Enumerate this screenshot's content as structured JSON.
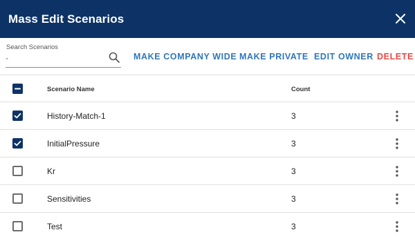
{
  "dialog": {
    "title": "Mass Edit Scenarios"
  },
  "search": {
    "label": "Search Scenarios",
    "value": "",
    "placeholder": "-"
  },
  "actions": {
    "make_company_wide": "MAKE COMPANY WIDE",
    "make_private": "MAKE PRIVATE",
    "edit_owner": "EDIT OWNER",
    "delete": "DELETE"
  },
  "table": {
    "headers": {
      "name": "Scenario Name",
      "count": "Count"
    },
    "select_all_state": "indeterminate",
    "rows": [
      {
        "name": "History-Match-1",
        "count": "3",
        "checked": true
      },
      {
        "name": "InitialPressure",
        "count": "3",
        "checked": true
      },
      {
        "name": "Kr",
        "count": "3",
        "checked": false
      },
      {
        "name": "Sensitivities",
        "count": "3",
        "checked": false
      },
      {
        "name": "Test",
        "count": "3",
        "checked": false
      }
    ]
  },
  "colors": {
    "header_bg": "#0d3366",
    "action_blue": "#2f77ba",
    "action_red": "#e24a43",
    "checkbox_checked": "#0d3366"
  },
  "icons": {
    "close": "close-icon",
    "search": "search-icon",
    "row_menu": "more-vert-icon",
    "checkbox_checked": "check-icon",
    "checkbox_indeterminate": "minus-icon"
  }
}
